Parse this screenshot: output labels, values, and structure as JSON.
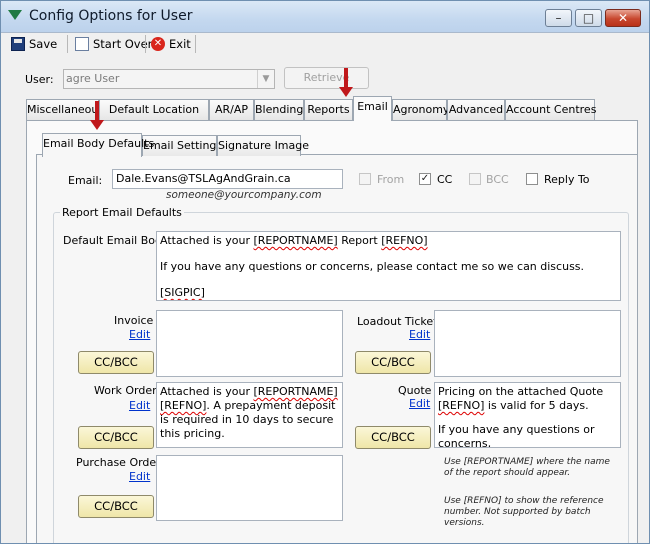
{
  "window": {
    "title": "Config Options for User",
    "minimize": "–",
    "maximize": "□",
    "close": "✕"
  },
  "toolbar": {
    "save": "Save",
    "start_over": "Start Over",
    "exit": "Exit",
    "exit_icon_glyph": "✕"
  },
  "user": {
    "label": "User:",
    "value": "agre User",
    "retrieve": "Retrieve"
  },
  "main_tabs": [
    "Miscellaneous",
    "Default Location",
    "AR/AP",
    "Blending",
    "Reports",
    "Email",
    "Agronomy",
    "Advanced",
    "Account Centres"
  ],
  "sub_tabs": [
    "Email Body Defaults",
    "Email Settings",
    "Signature Image"
  ],
  "email": {
    "label": "Email:",
    "value": "Dale.Evans@TSLAgAndGrain.ca",
    "hint": "someone@yourcompany.com",
    "from_label": "From",
    "from_checked": false,
    "cc_label": "CC",
    "cc_checked": true,
    "check_glyph": "✓",
    "bcc_label": "BCC",
    "bcc_checked": false,
    "reply_to_label": "Reply To",
    "reply_to_checked": false
  },
  "report_defaults": {
    "group_title": "Report Email Defaults",
    "default_body_label": "Default Email Body",
    "default_body_line1_a": "Attached is your ",
    "default_body_line1_b": "[REPORTNAME]",
    "default_body_line1_c": " Report ",
    "default_body_line1_d": "[REFNO]",
    "default_body_line2": "If you have any questions or concerns, please contact me so we can discuss.",
    "default_body_line3": "[SIGPIC]",
    "invoice_label": "Invoice",
    "loadout_label": "Loadout Ticket",
    "work_order_label": "Work Order",
    "work_order_text_a": "Attached is your ",
    "work_order_text_b": "[REPORTNAME]",
    "work_order_text_c": "[REFNO]",
    "work_order_text_d": ". A prepayment deposit is required in 10 days to secure this pricing.",
    "quote_label": "Quote",
    "quote_text_a": "Pricing on the attached Quote ",
    "quote_text_b": "[REFNO]",
    "quote_text_c": " is valid for 5 days.",
    "quote_text_d": "If you have any questions or concerns,",
    "purchase_order_label": "Purchase Order",
    "edit_label": "Edit",
    "ccbcc_label": "CC/BCC",
    "note1": "Use [REPORTNAME] where the name of the report should appear.",
    "note2": "Use [REFNO] to show the reference number. Not supported by batch versions."
  },
  "colors": {
    "accent_arrow": "#c0181b",
    "link": "#0033cc",
    "ccbcc_button": "#efe6a8"
  }
}
